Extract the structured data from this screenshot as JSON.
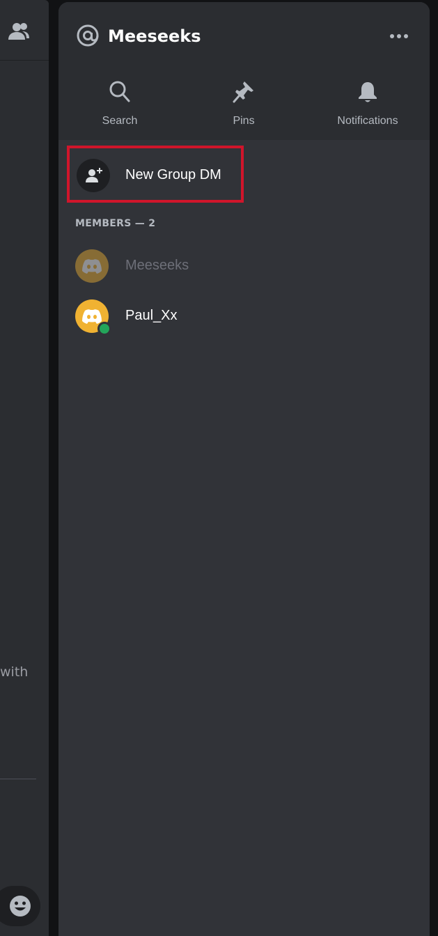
{
  "left_pane": {
    "header_icon": "people-icon",
    "partial_text": "with",
    "emoji_icon": "smiley-icon"
  },
  "panel": {
    "title_icon": "at-icon",
    "title": "Meeseeks",
    "more_icon": "more-horizontal-icon",
    "actions": [
      {
        "label": "Search",
        "icon": "search-icon"
      },
      {
        "label": "Pins",
        "icon": "pin-icon"
      },
      {
        "label": "Notifications",
        "icon": "bell-icon"
      }
    ],
    "new_group": {
      "label": "New Group DM",
      "icon": "add-person-icon",
      "highlight_color": "#d0152b"
    },
    "members_heading": "MEMBERS — 2",
    "members": [
      {
        "name": "Meeseeks",
        "status": "offline",
        "avatar_color": "#f0b232",
        "icon": "discord-logo-icon"
      },
      {
        "name": "Paul_Xx",
        "status": "online",
        "avatar_color": "#f0b232",
        "icon": "discord-logo-icon"
      }
    ]
  },
  "colors": {
    "background": "#313338",
    "header": "#2b2d31",
    "online": "#23a55a"
  }
}
